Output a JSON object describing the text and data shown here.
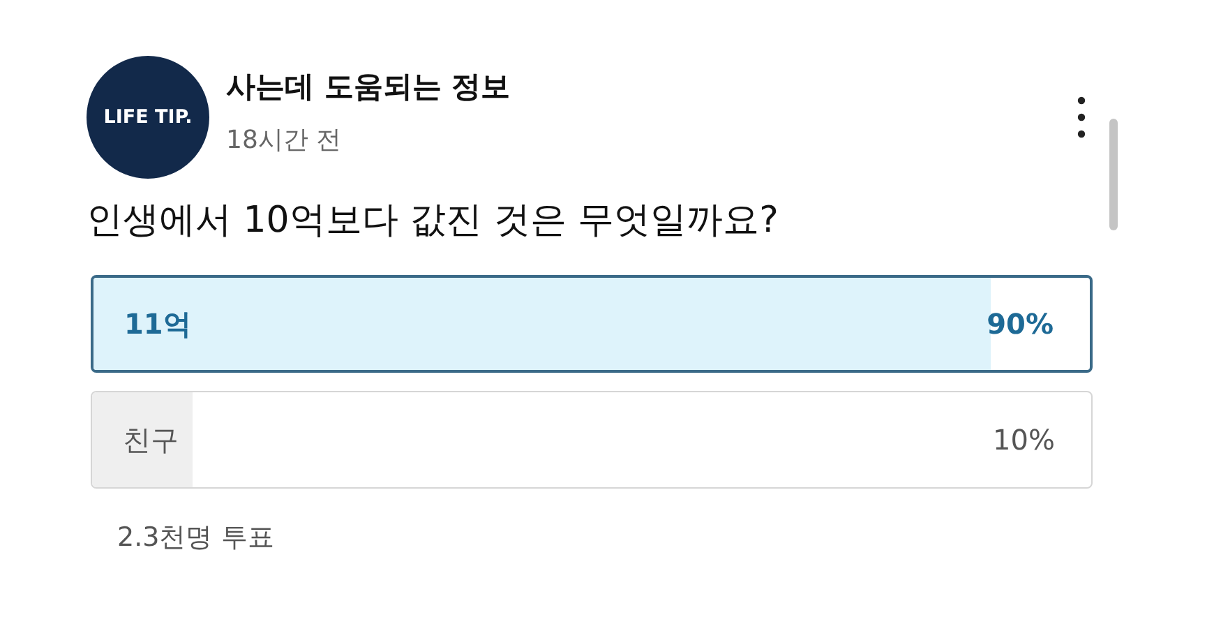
{
  "channel": {
    "avatar_text": "LIFE TIP.",
    "name": "사는데 도움되는 정보",
    "time": "18시간 전"
  },
  "question": "인생에서 10억보다 값진 것은 무엇일까요?",
  "options": [
    {
      "label": "11억",
      "percent": "90%",
      "level": 0.9,
      "selected": true
    },
    {
      "label": "친구",
      "percent": "10%",
      "level": 0.1,
      "selected": false
    }
  ],
  "votes": "2.3천명 투표"
}
